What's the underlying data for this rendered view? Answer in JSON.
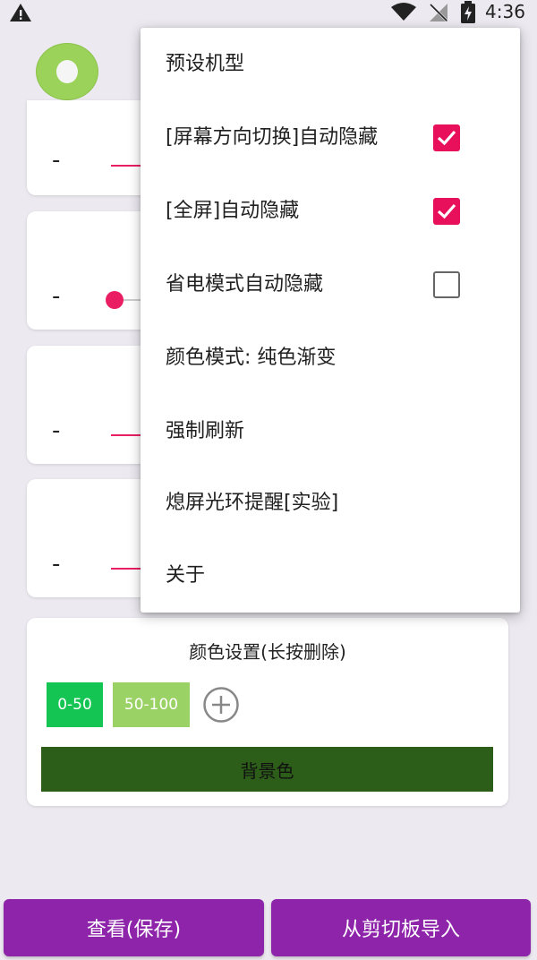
{
  "status_bar": {
    "time": "4:36",
    "icons": [
      "warning-icon",
      "wifi-icon",
      "no-signal-icon",
      "battery-charging-icon"
    ]
  },
  "background": {
    "slider_minus": "-",
    "color_settings": {
      "title": "颜色设置(长按删除)",
      "chips": [
        {
          "label": "0-50",
          "color": "#14c553"
        },
        {
          "label": "50-100",
          "color": "#9bd266"
        }
      ],
      "background_button": "背景色",
      "background_color": "#2d5e19"
    },
    "bottom_buttons": {
      "view_save": "查看(保存)",
      "import_clipboard": "从剪切板导入"
    }
  },
  "menu": {
    "items": [
      {
        "label": "预设机型"
      },
      {
        "label": "[屏幕方向切换]自动隐藏",
        "checked": true
      },
      {
        "label": "[全屏]自动隐藏",
        "checked": true
      },
      {
        "label": "省电模式自动隐藏",
        "checked": false
      },
      {
        "label": "颜色模式: 纯色渐变"
      },
      {
        "label": "强制刷新"
      },
      {
        "label": "熄屏光环提醒[实验]"
      },
      {
        "label": "关于"
      }
    ]
  },
  "colors": {
    "accent": "#e8105a",
    "primary_button": "#8e24aa"
  }
}
